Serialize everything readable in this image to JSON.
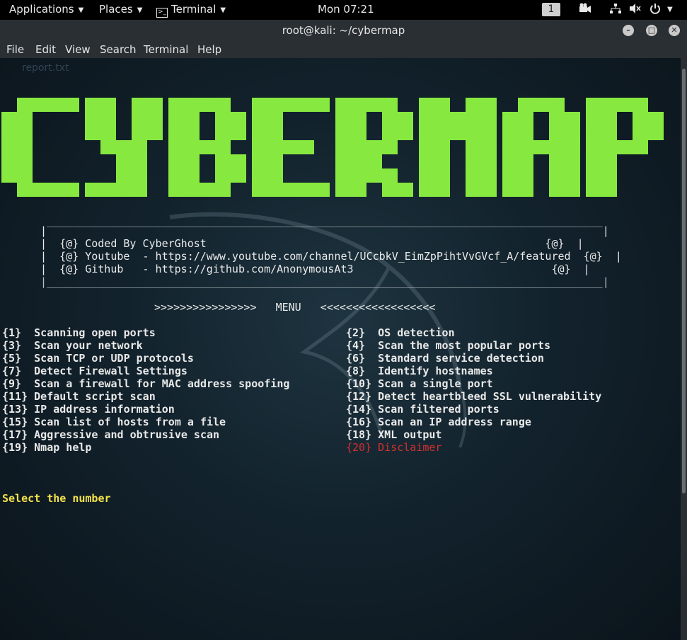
{
  "topbar": {
    "applications": "Applications",
    "places": "Places",
    "terminal": "Terminal",
    "clock": "Mon 07:21",
    "workspace": "1"
  },
  "window": {
    "title": "root@kali: ~/cybermap"
  },
  "menu": [
    "File",
    "Edit",
    "View",
    "Search",
    "Terminal",
    "Help"
  ],
  "ghost_file": "report.txt",
  "logo": {
    "text": "CYBERMAP",
    "color": "#87e83f"
  },
  "banner": {
    "top_border": " _______________________________________________________________________________________",
    "line_empty": "|                                                                                       |",
    "line1": "|  {@} Coded By CyberGhost                                                     {@}  |",
    "line2": "|  {@} Youtube  - https://www.youtube.com/channel/UCcbkV_EimZpPihtVvGVcf_A/featured  {@}  |",
    "line3": "|  {@} Github   - https://github.com/AnonymousAt3                               {@}  |",
    "bottom_border": "|_______________________________________________________________________________________|"
  },
  "menu_header": ">>>>>>>>>>>>>>>>   MENU   <<<<<<<<<<<<<<<<<<",
  "options_left": [
    "{1}  Scanning open ports",
    "{3}  Scan your network",
    "{5}  Scan TCP or UDP protocols",
    "{7}  Detect Firewall Settings",
    "{9}  Scan a firewall for MAC address spoofing",
    "{11} Default script scan",
    "{13} IP address information",
    "{15} Scan list of hosts from a file",
    "{17} Aggressive and obtrusive scan",
    "{19} Nmap help"
  ],
  "options_right": [
    "{2}  OS detection",
    "{4}  Scan the most popular ports",
    "{6}  Standard service detection",
    "{8}  Identify hostnames",
    "{10} Scan a single port",
    "{12} Detect heartbleed SSL vulnerability",
    "{14} Scan filtered ports",
    "{16} Scan an IP address range",
    "{18} XML output",
    "{20} Disclaimer"
  ],
  "prompt": "Select the number",
  "colors": {
    "logo": "#87e83f",
    "disclaimer": "#d32f2f",
    "prompt": "#f2e14a"
  }
}
